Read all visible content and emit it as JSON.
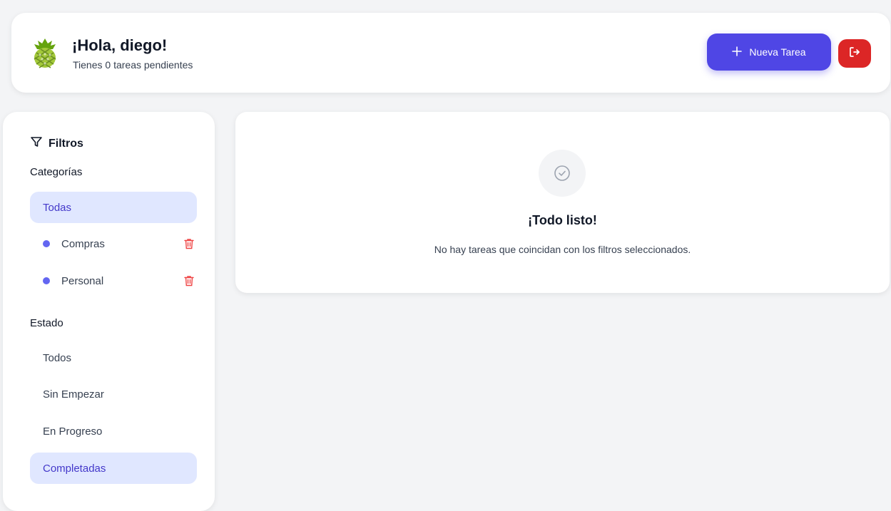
{
  "header": {
    "greeting": "¡Hola, diego!",
    "subtitle": "Tienes 0 tareas pendientes",
    "new_task_label": "Nueva Tarea",
    "new_task_icon": "plus-icon",
    "logout_icon": "logout-icon",
    "avatar_icon": "pineapple-logo-icon"
  },
  "sidebar": {
    "title": "Filtros",
    "title_icon": "filter-icon",
    "categories_label": "Categorías",
    "categories": [
      {
        "label": "Todas",
        "active": true
      },
      {
        "label": "Compras",
        "color": "#6366f1",
        "deletable": true
      },
      {
        "label": "Personal",
        "color": "#6366f1",
        "deletable": true
      }
    ],
    "status_label": "Estado",
    "statuses": [
      {
        "label": "Todos",
        "active": false
      },
      {
        "label": "Sin Empezar",
        "active": false
      },
      {
        "label": "En Progreso",
        "active": false
      },
      {
        "label": "Completadas",
        "active": true
      }
    ]
  },
  "main": {
    "empty_icon": "check-circle-icon",
    "empty_title": "¡Todo listo!",
    "empty_text": "No hay tareas que coincidan con los filtros seleccionados."
  },
  "colors": {
    "accent": "#4f46e5",
    "danger": "#dc2626",
    "active_bg": "#e0e7ff",
    "active_text": "#4338ca",
    "category_dot": "#6366f1"
  }
}
